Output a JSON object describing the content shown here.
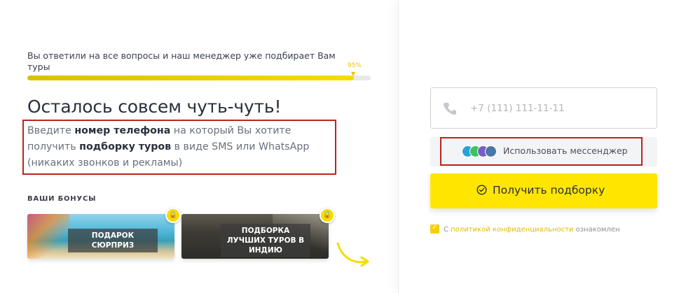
{
  "progress": {
    "text": "Вы ответили на все вопросы и наш менеджер уже подбирает Вам туры",
    "percent_label": "95%",
    "value": 0.95
  },
  "headline": "Осталось совсем чуть-чуть!",
  "intro": {
    "part1": "Введите ",
    "bold1": "номер телефона",
    "part2": " на который Вы хотите получить ",
    "bold2": "подборку туров",
    "part3": " в виде SMS или WhatsApp (никаких звонков и рекламы)"
  },
  "bonuses": {
    "title": "ВАШИ БОНУСЫ",
    "items": [
      {
        "label": "ПОДАРОК СЮРПРИЗ"
      },
      {
        "label": "ПОДБОРКА ЛУЧШИХ ТУРОВ В ИНДИЮ"
      }
    ]
  },
  "form": {
    "phone_placeholder": "+7 (111) 111-11-11",
    "phone_value": "",
    "messenger_label": "Использовать мессенджер",
    "messenger_icons": [
      "telegram-icon",
      "whatsapp-icon",
      "viber-icon",
      "vk-icon"
    ],
    "submit_label": "Получить подборку",
    "consent_prefix": "С",
    "consent_link": "политикой конфиденциальности",
    "consent_suffix": "ознакомлен",
    "consent_checked": true
  },
  "colors": {
    "accent": "#ffe600",
    "highlight_border": "#b8261f",
    "text_dark": "#2a2f3d",
    "text_muted": "#6b6f7c"
  }
}
